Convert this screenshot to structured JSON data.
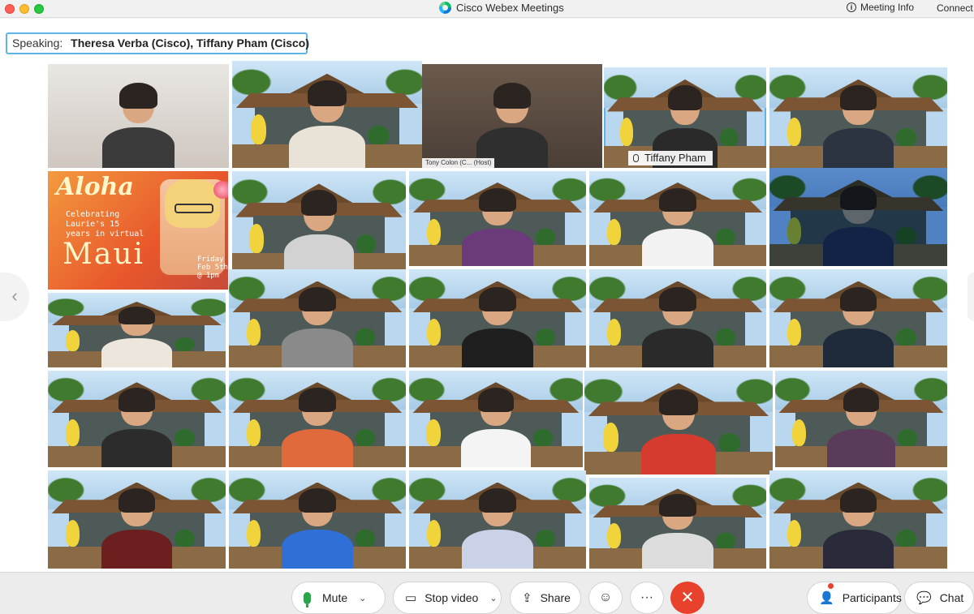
{
  "window": {
    "title": "Cisco Webex Meetings",
    "meeting_info_label": "Meeting Info",
    "connect_label": "Connect"
  },
  "speaking_banner": {
    "label": "Speaking:",
    "names": "Theresa Verba (Cisco),   Tiffany Pham (Cisco)"
  },
  "video_grid": {
    "active_speaker_name": "Tiffany Pham",
    "host_label": "Tony Colon (C...    (Host)",
    "aloha_card": {
      "title": "Aloha",
      "subtitle": "Celebrating Laurie's 15 years in virtual",
      "location": "Maui",
      "date": "Friday Feb 5th @ 1pm"
    }
  },
  "toolbar": {
    "mute_label": "Mute",
    "stop_video_label": "Stop video",
    "share_label": "Share",
    "participants_label": "Participants",
    "chat_label": "Chat",
    "accent_color": "#e8412c",
    "mic_color": "#2aa54a"
  }
}
